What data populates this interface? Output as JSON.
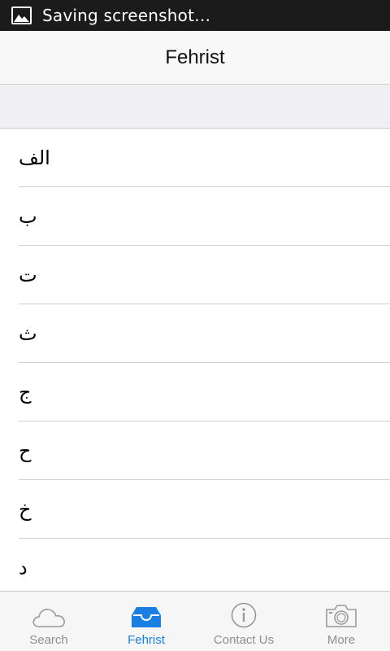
{
  "status_bar": {
    "text": "Saving screenshot…"
  },
  "nav": {
    "title": "Fehrist"
  },
  "list": {
    "items": [
      {
        "label": "الف"
      },
      {
        "label": "ب"
      },
      {
        "label": "ت"
      },
      {
        "label": "ث"
      },
      {
        "label": "ج"
      },
      {
        "label": "ح"
      },
      {
        "label": "خ"
      },
      {
        "label": "د"
      }
    ]
  },
  "tabs": [
    {
      "label": "Search",
      "icon": "cloud-icon",
      "active": false
    },
    {
      "label": "Fehrist",
      "icon": "inbox-icon",
      "active": true
    },
    {
      "label": "Contact Us",
      "icon": "info-icon",
      "active": false
    },
    {
      "label": "More",
      "icon": "camera-icon",
      "active": false
    }
  ],
  "colors": {
    "accent": "#1a7fe0",
    "inactive": "#8e8e8e",
    "status_bar": "#1b1b1b"
  }
}
